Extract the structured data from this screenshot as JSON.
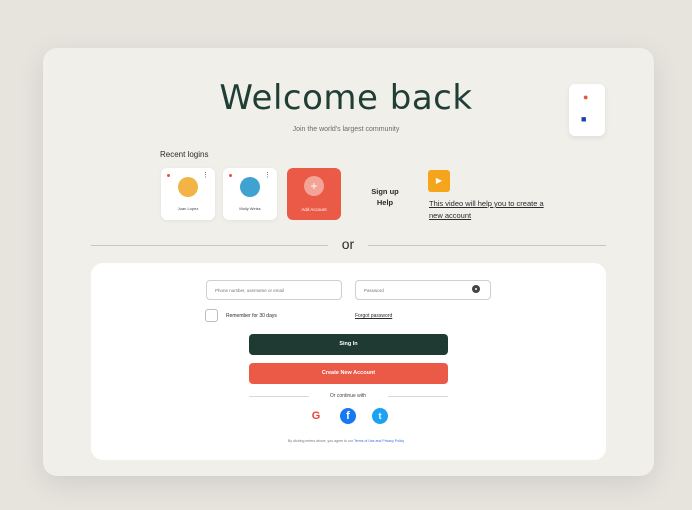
{
  "header": {
    "title": "Welcome back",
    "subtitle": "Join the world's largest community"
  },
  "side_widget": {
    "icons": [
      "pin-icon",
      "speaker-icon"
    ]
  },
  "recent_logins": {
    "label": "Recent logins",
    "accounts": [
      {
        "name": "Juan Lopez",
        "avatar_color": "#f2b347"
      },
      {
        "name": "Molly Weiss",
        "avatar_color": "#3fa2d1"
      }
    ],
    "add_account_label": "Add Account"
  },
  "help": {
    "signup_label": "Sign up",
    "help_label": "Help",
    "video_text": "This video will help you to create a new account"
  },
  "separator": "or",
  "form": {
    "username_placeholder": "Phone number, username or email",
    "password_placeholder": "Password",
    "remember_label": "Remember for 30 days",
    "forgot_label": "Forgot password",
    "signin_label": "Sing In",
    "create_label": "Create New Account",
    "continue_label": "Or continue with",
    "terms_text": "By clicking enters above, you agree to our ",
    "terms_link": "Terms of Use and Privacy Policy"
  },
  "social": {
    "google": "G",
    "facebook": "f",
    "twitter": "t"
  },
  "colors": {
    "primary_dark": "#1f3a32",
    "accent": "#ea5a46",
    "video_badge": "#f4a51c"
  }
}
